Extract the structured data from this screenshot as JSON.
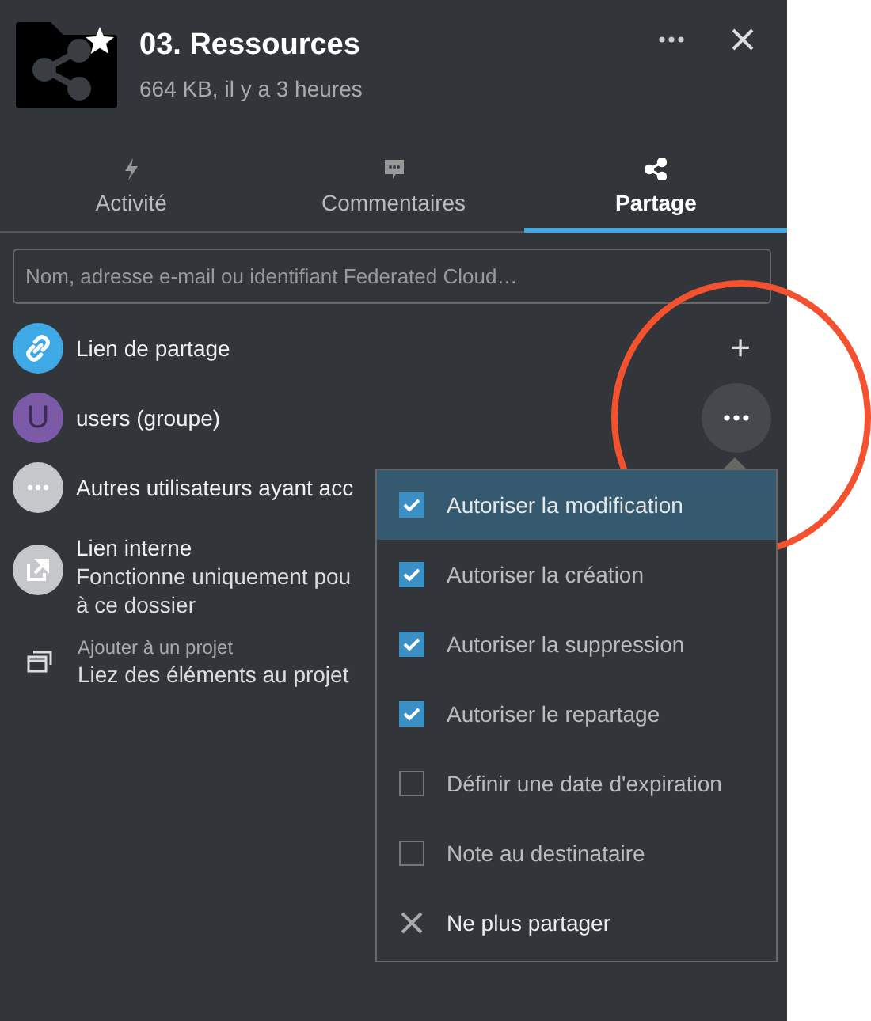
{
  "file": {
    "name": "03. Ressources",
    "meta": "664 KB, il y a 3 heures",
    "favorite": true
  },
  "tabs": [
    {
      "label": "Activité",
      "kind": "activity",
      "selected": false
    },
    {
      "label": "Commentaires",
      "kind": "comment",
      "selected": false
    },
    {
      "label": "Partage",
      "kind": "share",
      "selected": true
    }
  ],
  "search": {
    "placeholder": "Nom, adresse e-mail ou identifiant Federated Cloud…"
  },
  "shares": [
    {
      "kind": "link",
      "title": "Lien de partage",
      "action": "+"
    },
    {
      "kind": "group",
      "avatar": "U",
      "title": "users (groupe)",
      "menu_open": true
    },
    {
      "kind": "others",
      "title": "Autres utilisateurs ayant acc"
    },
    {
      "kind": "internal",
      "title": "Lien interne",
      "lines": [
        "Fonctionne uniquement pou",
        "à ce dossier"
      ]
    },
    {
      "kind": "project",
      "caption": "Ajouter à un projet",
      "title": "Liez des éléments au projet"
    }
  ],
  "menu": [
    {
      "kind": "checkbox",
      "label": "Autoriser la modification",
      "checked": true,
      "selected": true
    },
    {
      "kind": "checkbox",
      "label": "Autoriser la création",
      "checked": true,
      "selected": false
    },
    {
      "kind": "checkbox",
      "label": "Autoriser la suppression",
      "checked": true,
      "selected": false
    },
    {
      "kind": "checkbox",
      "label": "Autoriser le repartage",
      "checked": true,
      "selected": false
    },
    {
      "kind": "checkbox",
      "label": "Définir une date d'expiration",
      "checked": false,
      "selected": false
    },
    {
      "kind": "checkbox",
      "label": "Note au destinataire",
      "checked": false,
      "selected": false
    },
    {
      "kind": "action",
      "label": "Ne plus partager",
      "selected": false
    }
  ],
  "annotation": {
    "kind": "circle"
  }
}
